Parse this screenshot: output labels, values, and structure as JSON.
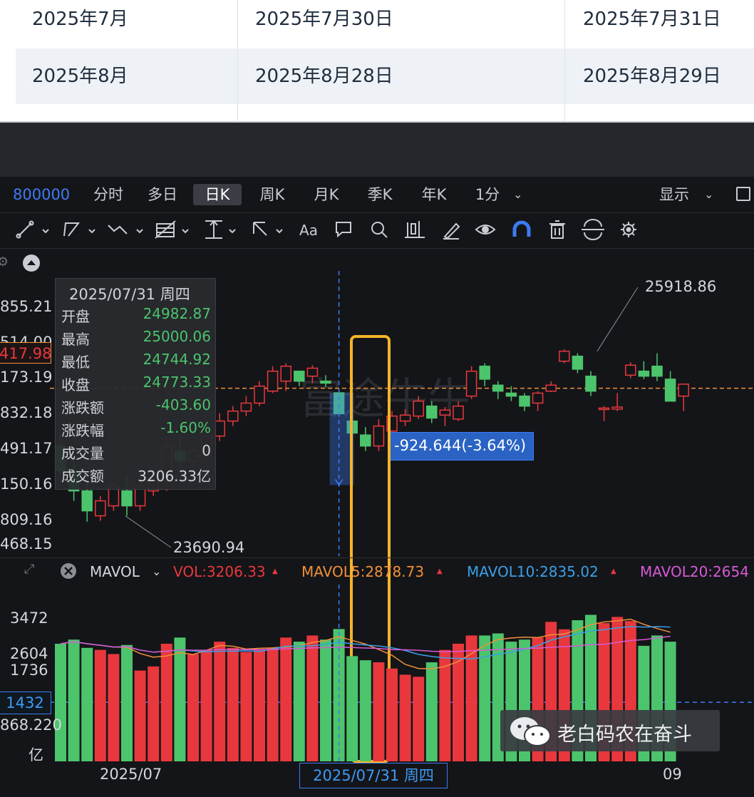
{
  "top_table": {
    "rows": [
      {
        "month": "2025年7月",
        "date_a": "2025年7月30日",
        "date_b": "2025年7月31日"
      },
      {
        "month": "2025年8月",
        "date_a": "2025年8月28日",
        "date_b": "2025年8月29日"
      }
    ]
  },
  "toolbar": {
    "symbol": "800000",
    "tabs": [
      "分时",
      "多日",
      "日K",
      "周K",
      "月K",
      "季K",
      "年K",
      "1分"
    ],
    "active_tab": "日K",
    "display_label": "显示",
    "font_tool": "Aa"
  },
  "price_axis": {
    "labels": [
      "855.21",
      "514.00",
      "417.98",
      "173.19",
      "832.18",
      "491.17",
      "150.16",
      "809.16",
      "468.15"
    ],
    "current_price_label": "417.98"
  },
  "annotations": {
    "high_label": "25918.86",
    "low_label": "23690.94",
    "measure_label": "-924.644(-3.64%)"
  },
  "tooltip": {
    "date": "2025/07/31 周四",
    "rows": [
      {
        "key": "开盘",
        "value": "24982.87",
        "color": "#4cc46c"
      },
      {
        "key": "最高",
        "value": "25000.06",
        "color": "#4cc46c"
      },
      {
        "key": "最低",
        "value": "24744.92",
        "color": "#4cc46c"
      },
      {
        "key": "收盘",
        "value": "24773.33",
        "color": "#4cc46c"
      },
      {
        "key": "涨跌额",
        "value": "-403.60",
        "color": "#4cc46c"
      },
      {
        "key": "涨跌幅",
        "value": "-1.60%",
        "color": "#4cc46c"
      },
      {
        "key": "成交量",
        "value": "0",
        "color": "#cfd2d8"
      },
      {
        "key": "成交额",
        "value": "3206.33亿",
        "color": "#cfd2d8"
      }
    ]
  },
  "volume_panel": {
    "indicator": "MAVOL",
    "vol": "VOL:3206.33",
    "mavol5": "MAVOL5:2878.73",
    "mavol10": "MAVOL10:2835.02",
    "mavol20": "MAVOL20:2654",
    "axis_labels": [
      "3472",
      "2604",
      "1736",
      "1432",
      "868.220",
      "亿"
    ],
    "crosshair_label": "1432"
  },
  "x_axis": {
    "labels": [
      "2025/07",
      "2025/07/31 周四",
      "09"
    ]
  },
  "watermark": "老白码农在奋斗",
  "colors": {
    "up": "#e8383d",
    "down": "#4cc46c",
    "accent": "#3d7bf5",
    "highlight_box": "#f5b42a",
    "ma5": "#f0903a",
    "ma10": "#3aa0e8",
    "ma20": "#d65ad6"
  },
  "chart_data": {
    "type": "candlestick",
    "candles": [
      {
        "o": 24450,
        "h": 24600,
        "l": 24150,
        "c": 24200
      },
      {
        "o": 24200,
        "h": 24350,
        "l": 23900,
        "c": 24000
      },
      {
        "o": 24000,
        "h": 24150,
        "l": 23690.94,
        "c": 23800
      },
      {
        "o": 23750,
        "h": 23950,
        "l": 23700,
        "c": 23900
      },
      {
        "o": 23850,
        "h": 24100,
        "l": 23800,
        "c": 24050
      },
      {
        "o": 24000,
        "h": 24150,
        "l": 23750,
        "c": 23850
      },
      {
        "o": 23850,
        "h": 24100,
        "l": 23800,
        "c": 24050
      },
      {
        "o": 24000,
        "h": 24200,
        "l": 23950,
        "c": 24100
      },
      {
        "o": 24100,
        "h": 24550,
        "l": 24000,
        "c": 24450
      },
      {
        "o": 24400,
        "h": 24550,
        "l": 24250,
        "c": 24300
      },
      {
        "o": 24300,
        "h": 24450,
        "l": 24250,
        "c": 24400
      },
      {
        "o": 24350,
        "h": 24620,
        "l": 24300,
        "c": 24550
      },
      {
        "o": 24550,
        "h": 24780,
        "l": 24500,
        "c": 24700
      },
      {
        "o": 24700,
        "h": 24850,
        "l": 24650,
        "c": 24800
      },
      {
        "o": 24800,
        "h": 24950,
        "l": 24750,
        "c": 24880
      },
      {
        "o": 24880,
        "h": 25100,
        "l": 24850,
        "c": 25050
      },
      {
        "o": 25000,
        "h": 25250,
        "l": 24980,
        "c": 25200
      },
      {
        "o": 25100,
        "h": 25280,
        "l": 25000,
        "c": 25250
      },
      {
        "o": 25200,
        "h": 25130,
        "l": 25050,
        "c": 25100
      },
      {
        "o": 25150,
        "h": 25260,
        "l": 25080,
        "c": 25230
      },
      {
        "o": 25100,
        "h": 25160,
        "l": 25040,
        "c": 25080
      },
      {
        "o": 24982.87,
        "h": 25000.06,
        "l": 24744.92,
        "c": 24773.33
      },
      {
        "o": 24700,
        "h": 24760,
        "l": 24520,
        "c": 24580
      },
      {
        "o": 24560,
        "h": 24640,
        "l": 24400,
        "c": 24450
      },
      {
        "o": 24450,
        "h": 24720,
        "l": 24400,
        "c": 24650
      },
      {
        "o": 24600,
        "h": 24800,
        "l": 24550,
        "c": 24750
      },
      {
        "o": 24700,
        "h": 24820,
        "l": 24650,
        "c": 24760
      },
      {
        "o": 24750,
        "h": 24950,
        "l": 24720,
        "c": 24900
      },
      {
        "o": 24850,
        "h": 24900,
        "l": 24680,
        "c": 24730
      },
      {
        "o": 24760,
        "h": 24840,
        "l": 24650,
        "c": 24810
      },
      {
        "o": 24720,
        "h": 24900,
        "l": 24700,
        "c": 24850
      },
      {
        "o": 24950,
        "h": 25250,
        "l": 24920,
        "c": 25200
      },
      {
        "o": 25250,
        "h": 25280,
        "l": 25050,
        "c": 25120
      },
      {
        "o": 25060,
        "h": 25100,
        "l": 24920,
        "c": 25000
      },
      {
        "o": 24980,
        "h": 25050,
        "l": 24900,
        "c": 24950
      },
      {
        "o": 24950,
        "h": 24980,
        "l": 24800,
        "c": 24850
      },
      {
        "o": 24880,
        "h": 25000,
        "l": 24800,
        "c": 24980
      },
      {
        "o": 25000,
        "h": 25100,
        "l": 24990,
        "c": 25060
      },
      {
        "o": 25300,
        "h": 25420,
        "l": 25280,
        "c": 25400
      },
      {
        "o": 25350,
        "h": 25380,
        "l": 25180,
        "c": 25220
      },
      {
        "o": 25150,
        "h": 25200,
        "l": 24950,
        "c": 25000
      },
      {
        "o": 24820,
        "h": 24850,
        "l": 24700,
        "c": 24830
      },
      {
        "o": 24820,
        "h": 24980,
        "l": 24800,
        "c": 24840
      },
      {
        "o": 25160,
        "h": 25290,
        "l": 25130,
        "c": 25260
      },
      {
        "o": 25200,
        "h": 25300,
        "l": 25120,
        "c": 25150
      },
      {
        "o": 25250,
        "h": 25380,
        "l": 25100,
        "c": 25150
      },
      {
        "o": 25120,
        "h": 25200,
        "l": 24920,
        "c": 24900
      },
      {
        "o": 24950,
        "h": 25050,
        "l": 24800,
        "c": 25070
      }
    ],
    "volumes": [
      2850,
      2950,
      2750,
      2700,
      2600,
      2820,
      2200,
      2300,
      2850,
      3000,
      2600,
      2700,
      2900,
      2750,
      2650,
      2700,
      2750,
      3000,
      2900,
      3050,
      2950,
      3206.33,
      2550,
      2450,
      2400,
      2250,
      2100,
      2050,
      2400,
      2700,
      2850,
      3050,
      3050,
      3100,
      2900,
      2950,
      3000,
      3380,
      3200,
      3420,
      3550,
      3350,
      3500,
      3400,
      2800,
      3050,
      2900
    ],
    "ylim": [
      23468.15,
      25855.21
    ]
  }
}
